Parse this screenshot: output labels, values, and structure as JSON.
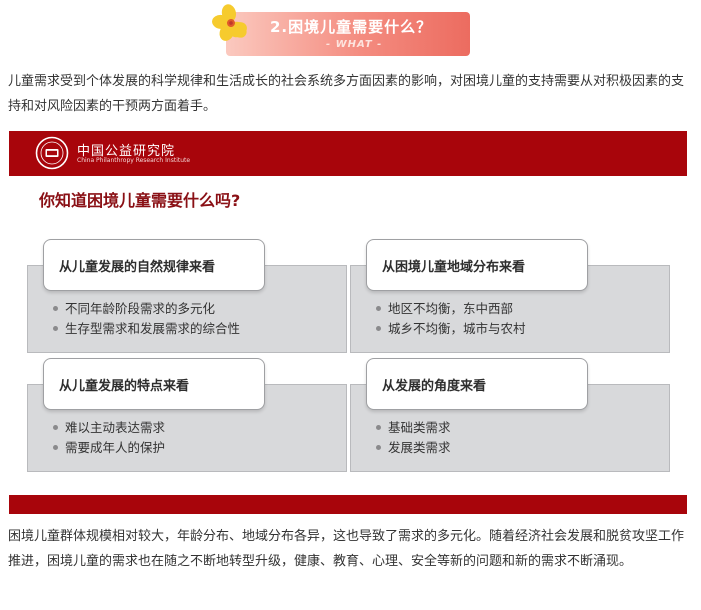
{
  "section_badge": {
    "title": "2.困境儿童需要什么？",
    "subtitle": "- WHAT -",
    "flower_color": "#f6cb2e",
    "gradient": [
      "#fbc9bf",
      "#ec6c60"
    ]
  },
  "intro_paragraph": "儿童需求受到个体发展的科学规律和生活成长的社会系统多方面因素的影响，对困境儿童的支持需要从对积极因素的支持和对风险因素的干预两方面着手。",
  "infographic": {
    "brand_color": "#a8050b",
    "org_name": "中国公益研究院",
    "org_name_en": "China Philanthropy Research Institute",
    "question": "你知道困境儿童需要什么吗?",
    "cards": [
      {
        "title": "从儿童发展的自然规律来看",
        "items": [
          "不同年龄阶段需求的多元化",
          "生存型需求和发展需求的综合性"
        ]
      },
      {
        "title": "从困境儿童地域分布来看",
        "items": [
          "地区不均衡，东中西部",
          "城乡不均衡，城市与农村"
        ]
      },
      {
        "title": "从儿童发展的特点来看",
        "items": [
          "难以主动表达需求",
          "需要成年人的保护"
        ]
      },
      {
        "title": "从发展的角度来看",
        "items": [
          "基础类需求",
          "发展类需求"
        ]
      }
    ]
  },
  "closing_paragraph": "困境儿童群体规模相对较大，年龄分布、地域分布各异，这也导致了需求的多元化。随着经济社会发展和脱贫攻坚工作推进，困境儿童的需求也在随之不断地转型升级，健康、教育、心理、安全等新的问题和新的需求不断涌现。"
}
